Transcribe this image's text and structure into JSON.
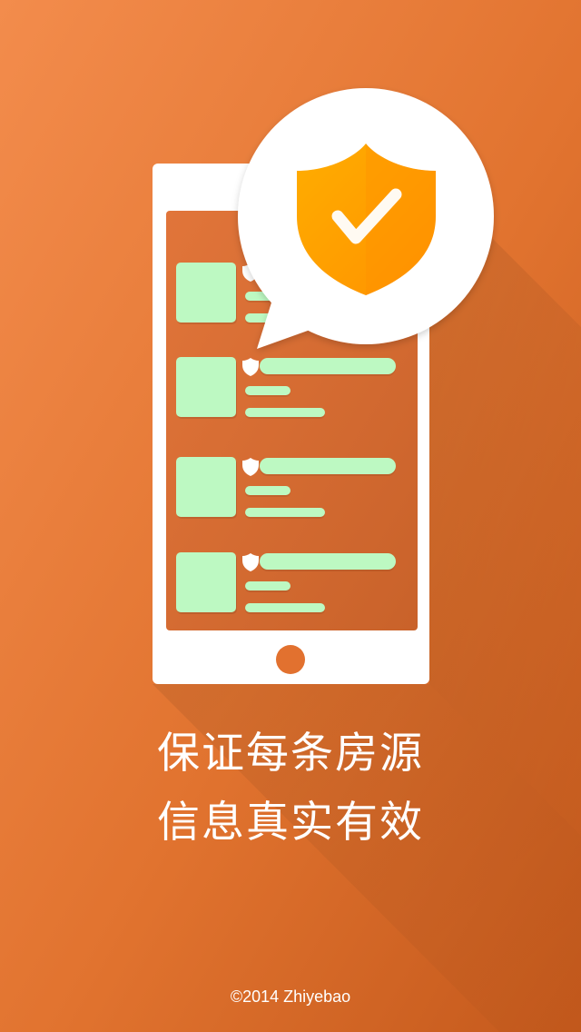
{
  "headline": {
    "line1": "保证每条房源",
    "line2": "信息真实有效"
  },
  "footer": {
    "copyright": "©2014 Zhiyebao"
  },
  "illustration": {
    "badge_icon": "shield-check-icon",
    "device_icon": "phone-icon",
    "list_items": [
      {
        "icon": "mini-shield-icon"
      },
      {
        "icon": "mini-shield-icon"
      },
      {
        "icon": "mini-shield-icon"
      },
      {
        "icon": "mini-shield-icon"
      }
    ]
  },
  "colors": {
    "background_top": "#f08a4b",
    "background_bottom": "#c8611f",
    "shield": "#ffa300",
    "placeholder": "#bdf9c2",
    "home_button": "#e2712f"
  }
}
